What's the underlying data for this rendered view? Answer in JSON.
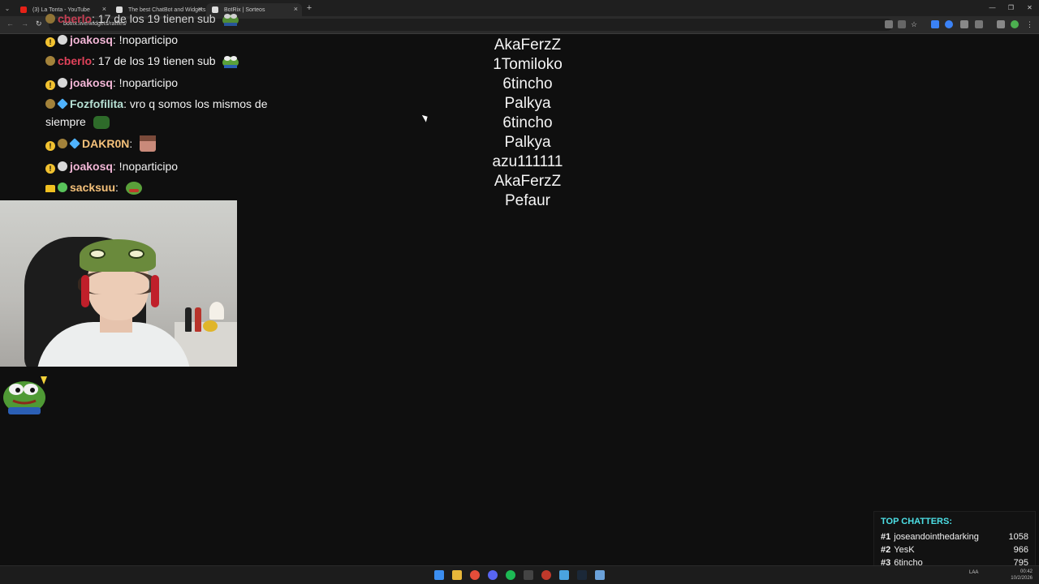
{
  "browser": {
    "tabs": [
      {
        "label": "(3) La Tonta - YouTube",
        "active": false,
        "favicon_color": "#e62117"
      },
      {
        "label": "The best ChatBot and Widgets",
        "active": false,
        "favicon_color": "#dddddd"
      },
      {
        "label": "BotRix | Sorteos",
        "active": true,
        "favicon_color": "#dddddd"
      }
    ],
    "url": "botrix.live/widgets/raffles/"
  },
  "chat": {
    "messages": [
      {
        "user": "cberlo",
        "user_color": "#e0425a",
        "text": ": 17 de los 19 tienen sub",
        "badges": [
          "bronze"
        ],
        "emote": "pepe"
      },
      {
        "user": "joakosq",
        "user_color": "#f2b6d6",
        "text": ": !noparticipo",
        "badges": [
          "alert",
          "white"
        ],
        "emote": ""
      },
      {
        "user": "cberlo",
        "user_color": "#e0425a",
        "text": ": 17 de los 19 tienen sub",
        "badges": [
          "bronze"
        ],
        "emote": "pepe"
      },
      {
        "user": "joakosq",
        "user_color": "#f2b6d6",
        "text": ": !noparticipo",
        "badges": [
          "alert",
          "white"
        ],
        "emote": ""
      },
      {
        "user": "Fozfofilita",
        "user_color": "#b6e0d4",
        "text": ": vro q somos los mismos de siempre",
        "badges": [
          "bronze",
          "blue"
        ],
        "emote": "green"
      },
      {
        "user": "DAKR0N",
        "user_color": "#f5c17a",
        "text": ":",
        "badges": [
          "alert",
          "bronze",
          "blue"
        ],
        "emote": "face"
      },
      {
        "user": "joakosq",
        "user_color": "#f2b6d6",
        "text": ": !noparticipo",
        "badges": [
          "alert",
          "white"
        ],
        "emote": ""
      },
      {
        "user": "sacksuu",
        "user_color": "#f5c17a",
        "text": ":",
        "badges": [
          "crown",
          "green"
        ],
        "emote": "pepe"
      }
    ]
  },
  "raffle": {
    "entries": [
      "AkaFerzZ",
      "1Tomiloko",
      "6tincho",
      "Palkya",
      "6tincho",
      "Palkya",
      "azu111111",
      "AkaFerzZ",
      "Pefaur"
    ]
  },
  "top_chatters": {
    "title": "TOP CHATTERS:",
    "rows": [
      {
        "rank": "#1",
        "name": "joseandointhedarking",
        "count": "1058"
      },
      {
        "rank": "#2",
        "name": "YesK",
        "count": "966"
      },
      {
        "rank": "#3",
        "name": "6tincho",
        "count": "795"
      }
    ]
  },
  "taskbar": {
    "lang": "LAA",
    "time": "00:42",
    "date": "10/2/2026"
  },
  "colors": {
    "accent_cyan": "#4de0e6",
    "background": "#0f0f0f"
  }
}
